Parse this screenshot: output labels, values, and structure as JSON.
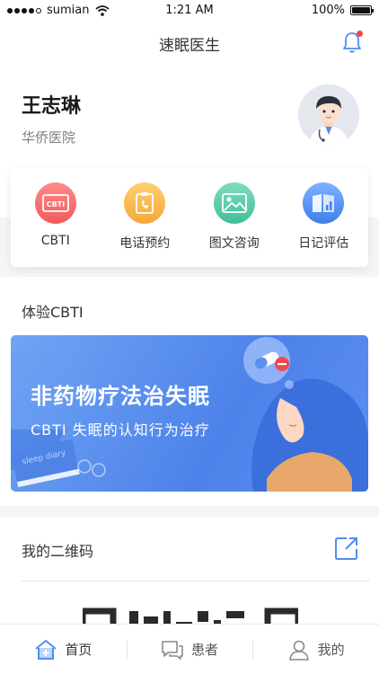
{
  "status_bar": {
    "carrier": "sumian",
    "time": "1:21 AM",
    "battery": "100%"
  },
  "nav": {
    "title": "速眠医生"
  },
  "profile": {
    "name": "王志琳",
    "hospital": "华侨医院"
  },
  "quick_actions": [
    {
      "label": "CBTI",
      "icon": "cbti-icon",
      "color": "#f46a6c"
    },
    {
      "label": "电话预约",
      "icon": "phone-icon",
      "color": "#f8b34a"
    },
    {
      "label": "图文咨询",
      "icon": "image-icon",
      "color": "#4fcaa5"
    },
    {
      "label": "日记评估",
      "icon": "diary-chart-icon",
      "color": "#4f8ff0"
    }
  ],
  "cbti_section": {
    "title": "体验CBTI",
    "banner_title": "非药物疗法治失眠",
    "banner_subtitle": "CBTI 失眠的认知行为治疗",
    "book_text": "sleep diary"
  },
  "qr_section": {
    "title": "我的二维码"
  },
  "tabbar": {
    "items": [
      {
        "label": "首页",
        "icon": "home-icon",
        "active": true
      },
      {
        "label": "患者",
        "icon": "chat-icon",
        "active": false
      },
      {
        "label": "我的",
        "icon": "user-icon",
        "active": false
      }
    ]
  },
  "colors": {
    "accent": "#4f8ff0",
    "notification_dot": "#f0484b"
  }
}
